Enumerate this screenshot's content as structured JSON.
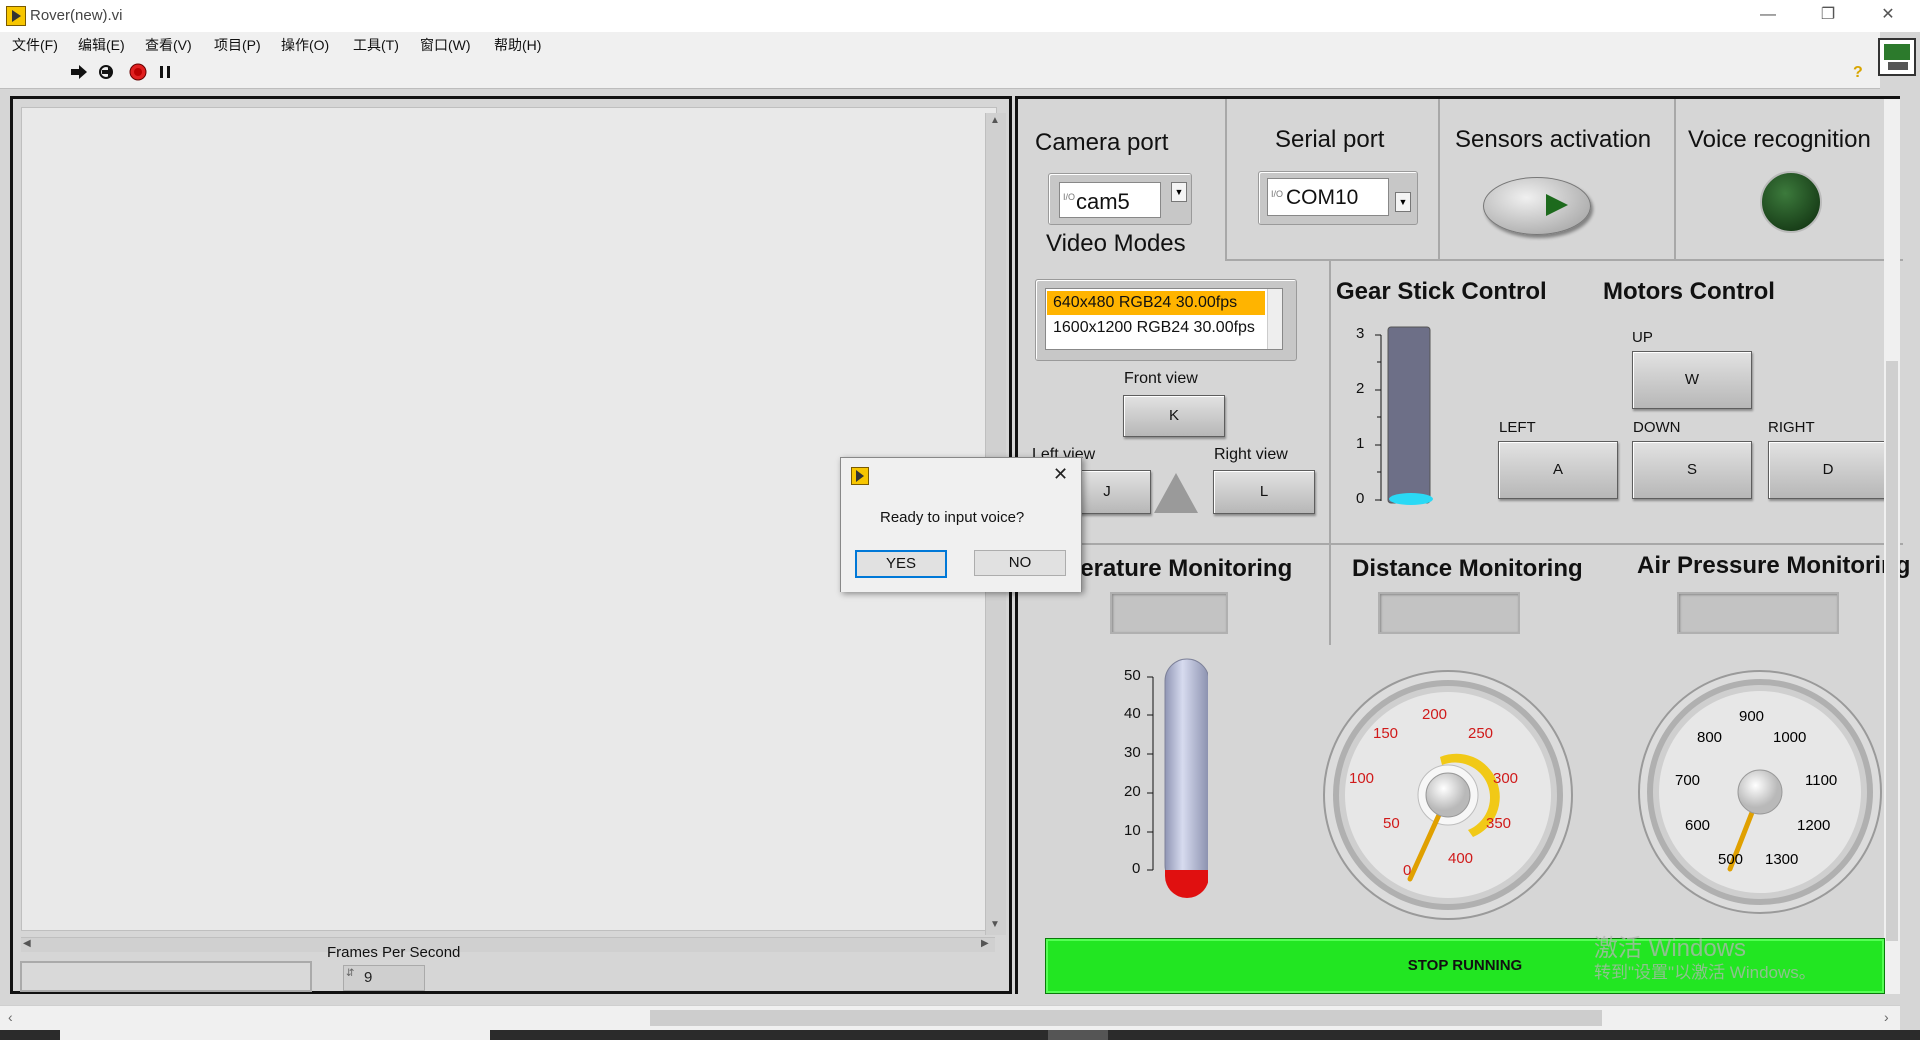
{
  "window": {
    "title": "Rover(new).vi",
    "minimize_icon": "minimize-icon",
    "restore_icon": "restore-icon",
    "close_icon": "close-icon"
  },
  "menu": [
    "文件(F)",
    "编辑(E)",
    "查看(V)",
    "项目(P)",
    "操作(O)",
    "工具(T)",
    "窗口(W)",
    "帮助(H)"
  ],
  "toolbar": {
    "icons": [
      "run-arrow-icon",
      "run-continuously-icon",
      "abort-icon",
      "pause-icon",
      "help-icon"
    ]
  },
  "left_panel": {
    "fps_label": "Frames Per Second",
    "fps_value": "9"
  },
  "camera": {
    "label": "Camera port",
    "value": "cam5",
    "prefix": "I/O"
  },
  "serial": {
    "label": "Serial port",
    "value": "COM10",
    "prefix": "I/O"
  },
  "sensors": {
    "label": "Sensors activation"
  },
  "voice": {
    "label": "Voice recognition"
  },
  "video_modes": {
    "label": "Video Modes",
    "items": [
      "640x480 RGB24 30.00fps",
      "1600x1200 RGB24 30.00fps"
    ],
    "selected_color": "#ffb400"
  },
  "views": {
    "front_label": "Front view",
    "front_key": "K",
    "left_label": "Left view",
    "left_key": "J",
    "right_label": "Right view",
    "right_key": "L"
  },
  "gear": {
    "label": "Gear Stick Control",
    "ticks": [
      "3",
      "2",
      "1",
      "0"
    ],
    "value": 0
  },
  "motors": {
    "label": "Motors Control",
    "up_label": "UP",
    "up_key": "W",
    "left_label": "LEFT",
    "left_key": "A",
    "down_label": "DOWN",
    "down_key": "S",
    "right_label": "RIGHT",
    "right_key": "D"
  },
  "temperature": {
    "label": "Temperature Monitoring",
    "ticks": [
      "50",
      "40",
      "30",
      "20",
      "10",
      "0"
    ]
  },
  "distance": {
    "label": "Distance Monitoring",
    "ticks": [
      "0",
      "50",
      "100",
      "150",
      "200",
      "250",
      "300",
      "350",
      "400"
    ],
    "tick_color": "#d01a1a"
  },
  "pressure": {
    "label": "Air Pressure Monitoring",
    "ticks": [
      "500",
      "600",
      "700",
      "800",
      "900",
      "1000",
      "1100",
      "1200",
      "1300"
    ]
  },
  "stop_button": {
    "label": "STOP RUNNING",
    "color": "#22e622"
  },
  "dialog": {
    "message": "Ready to input voice?",
    "yes_label": "YES",
    "no_label": "NO"
  },
  "watermark": {
    "line1": "激活 Windows",
    "line2": "转到\"设置\"以激活 Windows。"
  }
}
